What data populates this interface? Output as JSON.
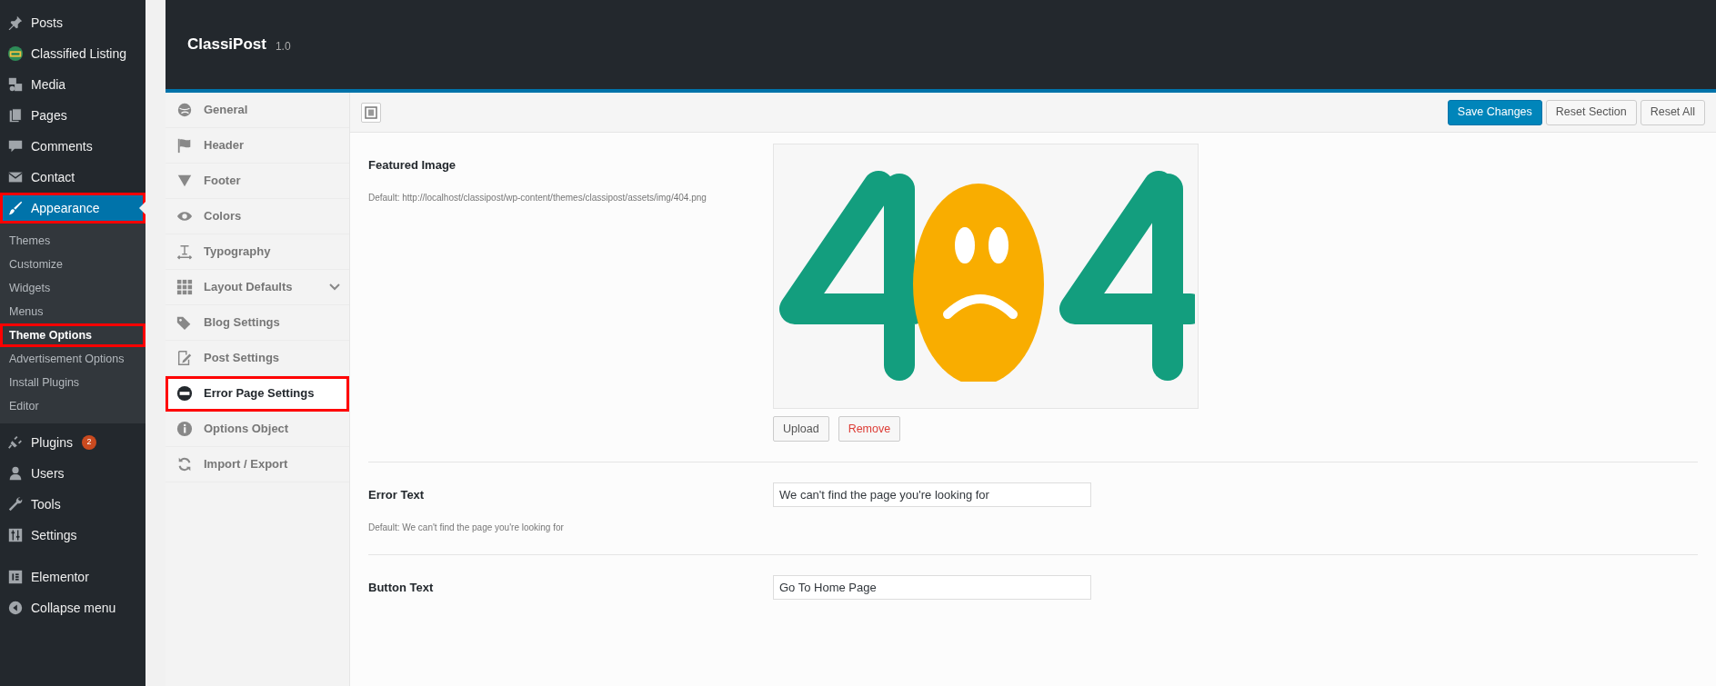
{
  "admin_menu": [
    {
      "label": "Posts",
      "selected": false,
      "outlined": false
    },
    {
      "label": "Classified Listing",
      "selected": false,
      "outlined": false
    },
    {
      "label": "Media",
      "selected": false,
      "outlined": false
    },
    {
      "label": "Pages",
      "selected": false,
      "outlined": false
    },
    {
      "label": "Comments",
      "selected": false,
      "outlined": false
    },
    {
      "label": "Contact",
      "selected": false,
      "outlined": false
    },
    {
      "label": "Appearance",
      "selected": true,
      "outlined": true,
      "submenu": [
        {
          "label": "Themes",
          "selected": false,
          "outlined": false
        },
        {
          "label": "Customize",
          "selected": false,
          "outlined": false
        },
        {
          "label": "Widgets",
          "selected": false,
          "outlined": false
        },
        {
          "label": "Menus",
          "selected": false,
          "outlined": false
        },
        {
          "label": "Theme Options",
          "selected": true,
          "outlined": true
        },
        {
          "label": "Advertisement Options",
          "selected": false,
          "outlined": false
        },
        {
          "label": "Install Plugins",
          "selected": false,
          "outlined": false
        },
        {
          "label": "Editor",
          "selected": false,
          "outlined": false
        }
      ]
    },
    {
      "label": "Plugins",
      "badge": "2",
      "selected": false,
      "outlined": false
    },
    {
      "label": "Users",
      "selected": false,
      "outlined": false
    },
    {
      "label": "Tools",
      "selected": false,
      "outlined": false
    },
    {
      "label": "Settings",
      "selected": false,
      "outlined": false
    },
    {
      "label": "Elementor",
      "selected": false,
      "outlined": false
    },
    {
      "label": "Collapse menu",
      "selected": false,
      "outlined": false
    }
  ],
  "header": {
    "title": "ClassiPost",
    "version": "1.0"
  },
  "options_nav": [
    {
      "label": "General",
      "selected": false,
      "outlined": false,
      "expandable": false
    },
    {
      "label": "Header",
      "selected": false,
      "outlined": false,
      "expandable": false
    },
    {
      "label": "Footer",
      "selected": false,
      "outlined": false,
      "expandable": false
    },
    {
      "label": "Colors",
      "selected": false,
      "outlined": false,
      "expandable": false
    },
    {
      "label": "Typography",
      "selected": false,
      "outlined": false,
      "expandable": false
    },
    {
      "label": "Layout Defaults",
      "selected": false,
      "outlined": false,
      "expandable": true
    },
    {
      "label": "Blog Settings",
      "selected": false,
      "outlined": false,
      "expandable": false
    },
    {
      "label": "Post Settings",
      "selected": false,
      "outlined": false,
      "expandable": false
    },
    {
      "label": "Error Page Settings",
      "selected": true,
      "outlined": true,
      "expandable": false
    },
    {
      "label": "Options Object",
      "selected": false,
      "outlined": false,
      "expandable": false
    },
    {
      "label": "Import / Export",
      "selected": false,
      "outlined": false,
      "expandable": false
    }
  ],
  "toolbar": {
    "buttons": [
      {
        "label": "Save Changes",
        "kind": "primary"
      },
      {
        "label": "Reset Section",
        "kind": "secondary"
      },
      {
        "label": "Reset All",
        "kind": "secondary"
      }
    ]
  },
  "fields": [
    {
      "kind": "image",
      "label": "Featured Image",
      "description": "Default: http://localhost/classipost/wp-content/themes/classipost/assets/img/404.png",
      "buttons": [
        {
          "label": "Upload",
          "kind": "normal"
        },
        {
          "label": "Remove",
          "kind": "danger"
        }
      ]
    },
    {
      "kind": "text",
      "label": "Error Text",
      "description": "Default: We can't find the page you're looking for",
      "value": "We can't find the page you're looking for"
    },
    {
      "kind": "text",
      "label": "Button Text",
      "value": "Go To Home Page"
    }
  ]
}
